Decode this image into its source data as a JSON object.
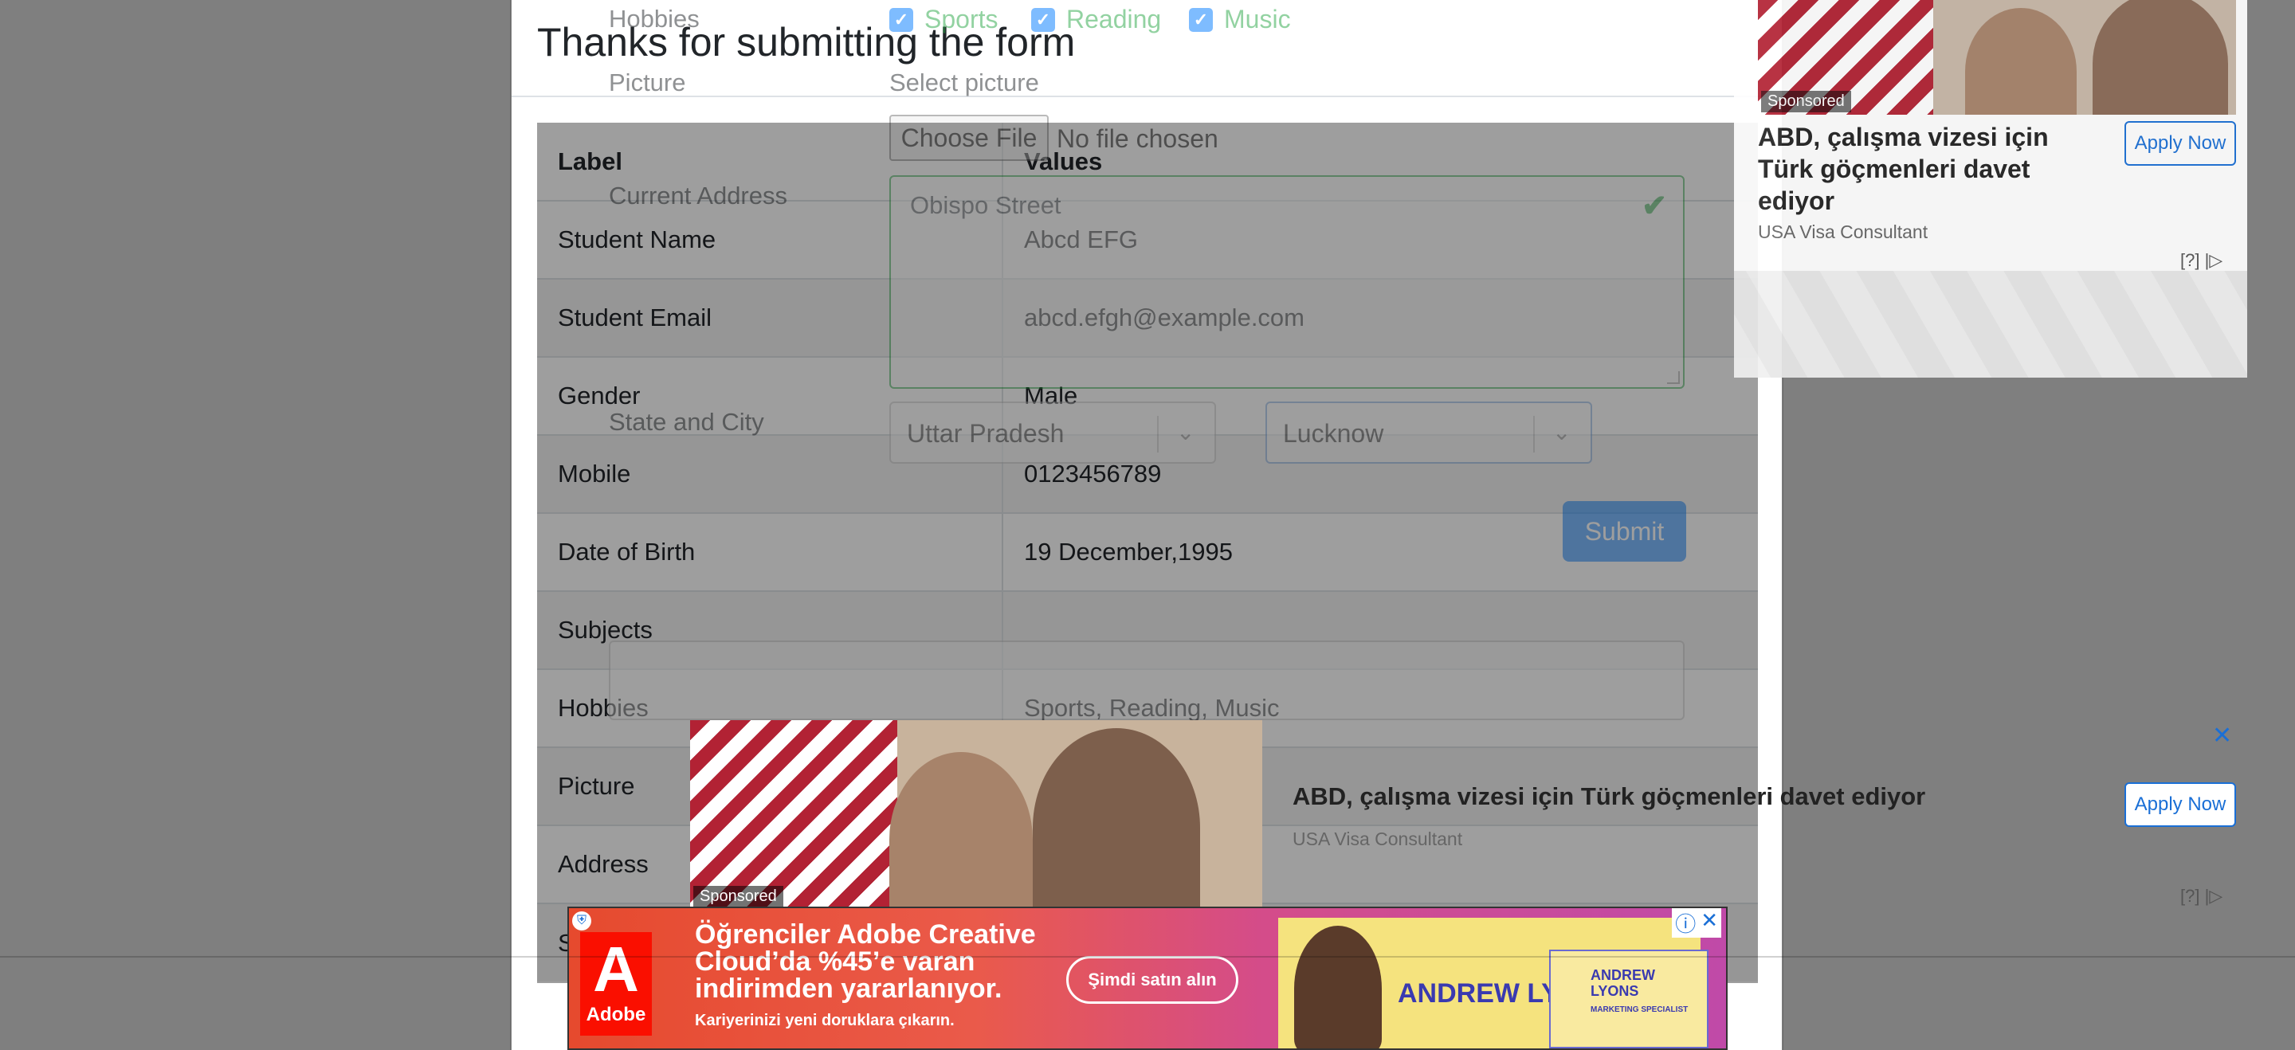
{
  "form": {
    "hobbies_label": "Hobbies",
    "hobbies": [
      "Sports",
      "Reading",
      "Music"
    ],
    "picture_label": "Picture",
    "select_picture": "Select picture",
    "choose_file": "Choose File",
    "no_file": "No file chosen",
    "address_label": "Current Address",
    "address_value": "Obisp‌o Street",
    "state_city_label": "State and City",
    "state_value": "Uttar Pradesh",
    "city_value": "Lucknow",
    "submit_label": "Submit"
  },
  "modal": {
    "title": "Thanks for submitting the form",
    "header": {
      "label": "Label",
      "values": "Values"
    },
    "rows": [
      {
        "label": "Student Name",
        "value": "Abcd EFG"
      },
      {
        "label": "Student Email",
        "value": "abcd.efgh@example.com"
      },
      {
        "label": "Gender",
        "value": "Male"
      },
      {
        "label": "Mobile",
        "value": "0123456789"
      },
      {
        "label": "Date of Birth",
        "value": "19 December,1995"
      },
      {
        "label": "Subjects",
        "value": ""
      },
      {
        "label": "Hobbies",
        "value": "Sports, Reading, Music"
      },
      {
        "label": "Picture",
        "value": ""
      },
      {
        "label": "Address",
        "value": "Obispo Street"
      },
      {
        "label": "S",
        "value": ""
      }
    ]
  },
  "ad_top": {
    "sponsored": "Sponsored",
    "title": "ABD, çalışma vizesi için Türk göçmenleri davet ediyor",
    "source": "USA Visa Consultant",
    "cta": "Apply Now",
    "adchoice": "[?]"
  },
  "ad_mid": {
    "sponsored": "Sponsored",
    "title": "ABD, çalışma vizesi için Türk göçmenleri davet ediyor",
    "source": "USA Visa Consultant",
    "cta": "Apply Now",
    "adchoice": "[?]"
  },
  "ad_bottom": {
    "brand": "Adobe",
    "headline": "Öğrenciler Adobe Creative Cloud’da %45’e varan indirimden yararlanıyor.",
    "sub": "Kariyerinizi yeni doruklara çıkarın.",
    "cta": "Şimdi satın alın",
    "person_name": "ANDREW LYONS",
    "card_name": "ANDREW LYONS",
    "card_title": "MARKETING SPECIALIST"
  },
  "colors": {
    "primary": "#007bff",
    "success": "#28a745",
    "adobe_red": "#fa0f00"
  },
  "icons": [
    "check-icon",
    "chevron-down-icon",
    "close-icon",
    "info-icon",
    "adchoices-icon",
    "shield-icon"
  ]
}
